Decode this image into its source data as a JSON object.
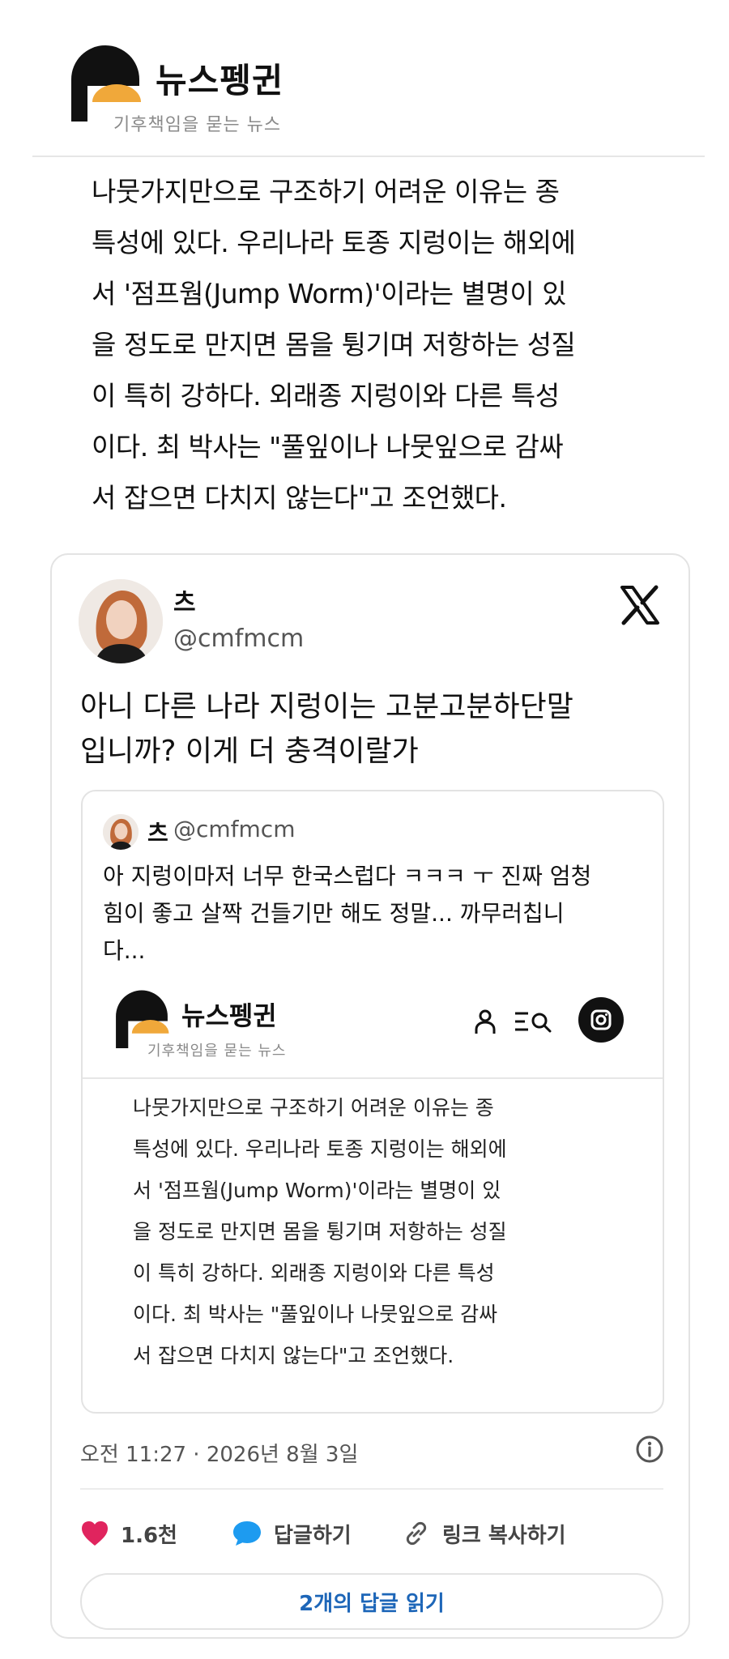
{
  "site": {
    "brand": "뉴스펭귄",
    "tagline": "기후책임을 묻는 뉴스"
  },
  "article": {
    "lines": [
      "나뭇가지만으로 구조하기 어려운 이유는 종",
      "특성에 있다. 우리나라 토종 지렁이는 해외에",
      "서 '점프웜(Jump Worm)'이라는 별명이 있",
      "을 정도로 만지면 몸을 튕기며 저항하는 성질",
      "이 특히 강하다. 외래종 지렁이와 다른 특성",
      "이다. 최 박사는 \"풀잎이나 나뭇잎으로 감싸",
      "서 잡으면 다치지 않는다\"고 조언했다."
    ]
  },
  "tweet": {
    "author_name": "츠",
    "handle": "@cmfmcm",
    "text_lines": [
      "아니 다른 나라 지렁이는 고분고분하단말",
      "입니까? 이게 더 충격이랄가"
    ],
    "quote": {
      "author_name": "츠",
      "handle": "@cmfmcm",
      "text_lines": [
        "아 지렁이마저 너무 한국스럽다 ㅋㅋㅋ ㅜ 진짜 엄청",
        "힘이 좋고 살짝 건들기만 해도 정말... 까무러칩니",
        "다..."
      ],
      "embed": {
        "brand": "뉴스펭귄",
        "tagline": "기후책임을 묻는 뉴스",
        "lines": [
          "나뭇가지만으로 구조하기 어려운 이유는 종",
          "특성에 있다. 우리나라 토종 지렁이는 해외에",
          "서 '점프웜(Jump Worm)'이라는 별명이 있",
          "을 정도로 만지면 몸을 튕기며 저항하는 성질",
          "이 특히 강하다. 외래종 지렁이와 다른 특성",
          "이다. 최 박사는 \"풀잎이나 나뭇잎으로 감싸",
          "서 잡으면 다치지 않는다\"고 조언했다."
        ]
      }
    },
    "timestamp": "오전 11:27 · 2026년 8월 3일",
    "like_count": "1.6천",
    "reply_label": "답글하기",
    "copy_link_label": "링크 복사하기",
    "read_replies_label": "2개의 답글 읽기"
  },
  "colors": {
    "accent_orange": "#f0a83a",
    "like_red": "#e0245e",
    "reply_blue": "#1d9bf0",
    "link_blue": "#1d66b8"
  },
  "icons": {
    "like": "heart-icon",
    "reply": "speech-bubble-icon",
    "copy_link": "link-icon",
    "info": "info-icon",
    "platform": "x-logo-icon"
  }
}
